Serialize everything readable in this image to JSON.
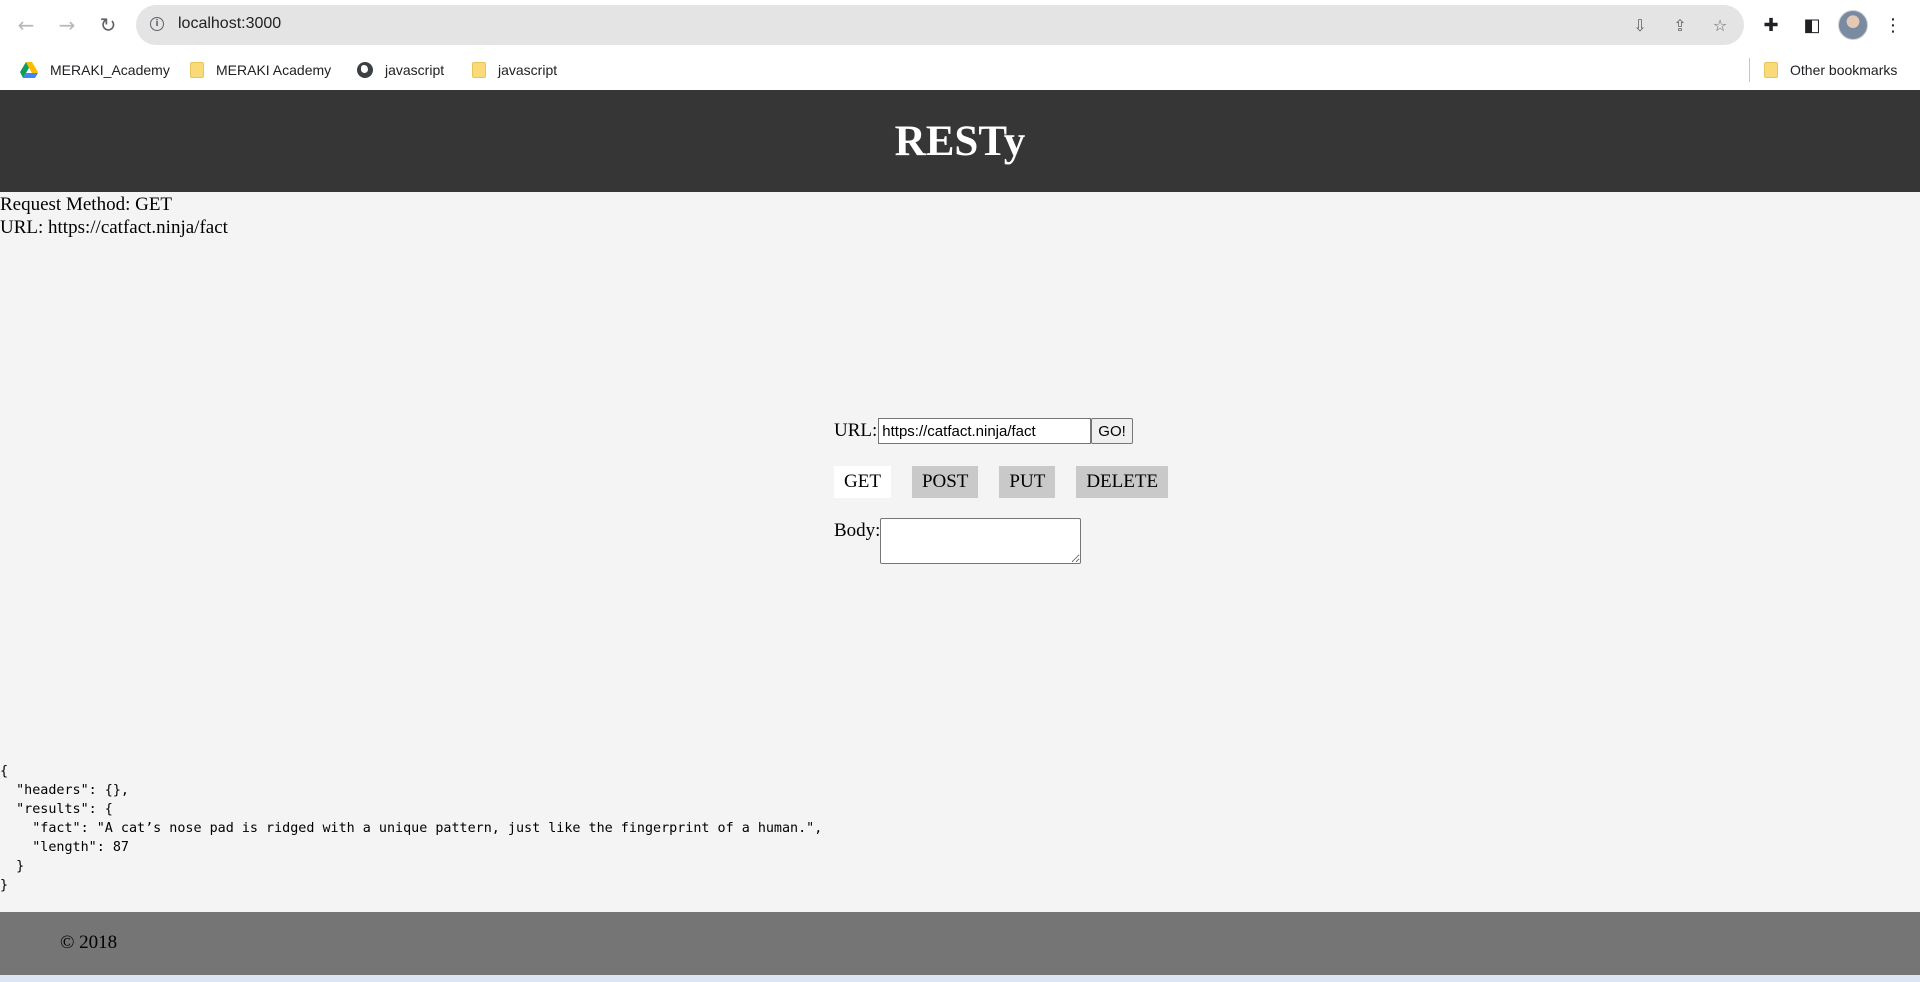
{
  "browser": {
    "address": "localhost:3000",
    "bookmarks": [
      {
        "label": "MERAKI_Academy",
        "icon": "google-drive-icon"
      },
      {
        "label": "MERAKI Academy",
        "icon": "folder-icon"
      },
      {
        "label": "javascript",
        "icon": "globe-icon"
      },
      {
        "label": "javascript",
        "icon": "folder-icon"
      }
    ],
    "other_bookmarks": "Other bookmarks"
  },
  "app": {
    "title": "RESTy",
    "request": {
      "method_line": "Request Method: GET",
      "url_line": "URL: https://catfact.ninja/fact"
    },
    "form": {
      "url_label": "URL:",
      "url_value": "https://catfact.ninja/fact",
      "go_label": "GO!",
      "methods": [
        "GET",
        "POST",
        "PUT",
        "DELETE"
      ],
      "active_method": "GET",
      "body_label": "Body:",
      "body_value": ""
    },
    "results_json": "{\n  \"headers\": {},\n  \"results\": {\n    \"fact\": \"A cat’s nose pad is ridged with a unique pattern, just like the fingerprint of a human.\",\n    \"length\": 87\n  }\n}",
    "footer": "© 2018"
  }
}
